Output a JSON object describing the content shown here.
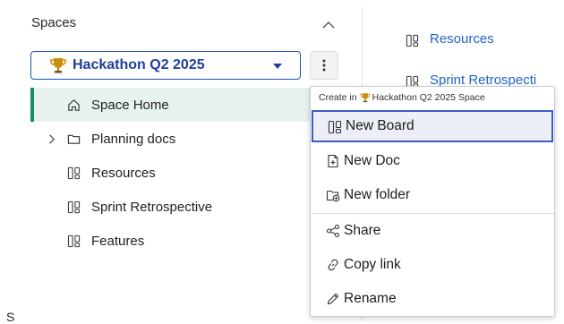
{
  "sidebar": {
    "title": "Spaces",
    "space_selector": {
      "name": "Hackathon Q2 2025"
    },
    "tree": [
      {
        "label": "Space Home",
        "icon": "home-icon",
        "active": true
      },
      {
        "label": "Planning docs",
        "icon": "folder-icon",
        "expandable": true
      },
      {
        "label": "Resources",
        "icon": "board-icon"
      },
      {
        "label": "Sprint Retrospective",
        "icon": "board-icon"
      },
      {
        "label": "Features",
        "icon": "board-icon"
      }
    ]
  },
  "content": {
    "links": [
      {
        "label": "Resources",
        "icon": "board-icon"
      },
      {
        "label": "Sprint Retrospecti",
        "icon": "board-icon"
      }
    ]
  },
  "menu": {
    "header_prefix": "Create in",
    "header_space": "Hackathon Q2 2025 Space",
    "items": [
      {
        "label": "New Board",
        "icon": "board-icon",
        "focused": true
      },
      {
        "label": "New Doc",
        "icon": "new-doc-icon"
      },
      {
        "label": "New folder",
        "icon": "new-folder-icon"
      },
      {
        "label": "Share",
        "icon": "share-icon"
      },
      {
        "label": "Copy link",
        "icon": "link-icon"
      },
      {
        "label": "Rename",
        "icon": "pencil-icon"
      }
    ]
  },
  "footer": {
    "partial_text": "S"
  },
  "colors": {
    "accent": "#1f3f99",
    "active_bar": "#178b71",
    "active_bg": "#e7f2ef",
    "link": "#1f63c9",
    "trophy": "#c9900b"
  }
}
